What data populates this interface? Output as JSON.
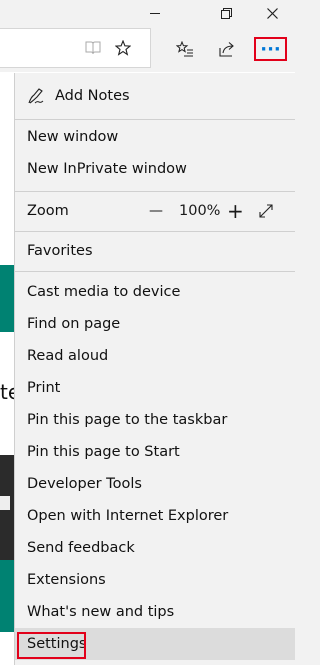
{
  "window": {
    "minimize_icon": "minimize-icon",
    "restore_icon": "restore-icon",
    "close_icon": "close-icon"
  },
  "toolbar": {
    "reading_view_icon": "book-icon",
    "favorite_icon": "star-icon",
    "favorites_hub_icon": "favorites-list-icon",
    "share_icon": "share-icon",
    "more_label": "···"
  },
  "background": {
    "partial_text": "te"
  },
  "menu": {
    "add_notes": "Add Notes",
    "new_window": "New window",
    "new_inprivate": "New InPrivate window",
    "zoom_label": "Zoom",
    "zoom_minus": "—",
    "zoom_value": "100%",
    "zoom_plus": "+",
    "favorites": "Favorites",
    "cast": "Cast media to device",
    "find": "Find on page",
    "read_aloud": "Read aloud",
    "print": "Print",
    "pin_taskbar": "Pin this page to the taskbar",
    "pin_start": "Pin this page to Start",
    "dev_tools": "Developer Tools",
    "open_ie": "Open with Internet Explorer",
    "feedback": "Send feedback",
    "extensions": "Extensions",
    "whats_new": "What's new and tips",
    "settings": "Settings"
  },
  "colors": {
    "highlight": "#e2001a",
    "accent": "#0078d7"
  }
}
